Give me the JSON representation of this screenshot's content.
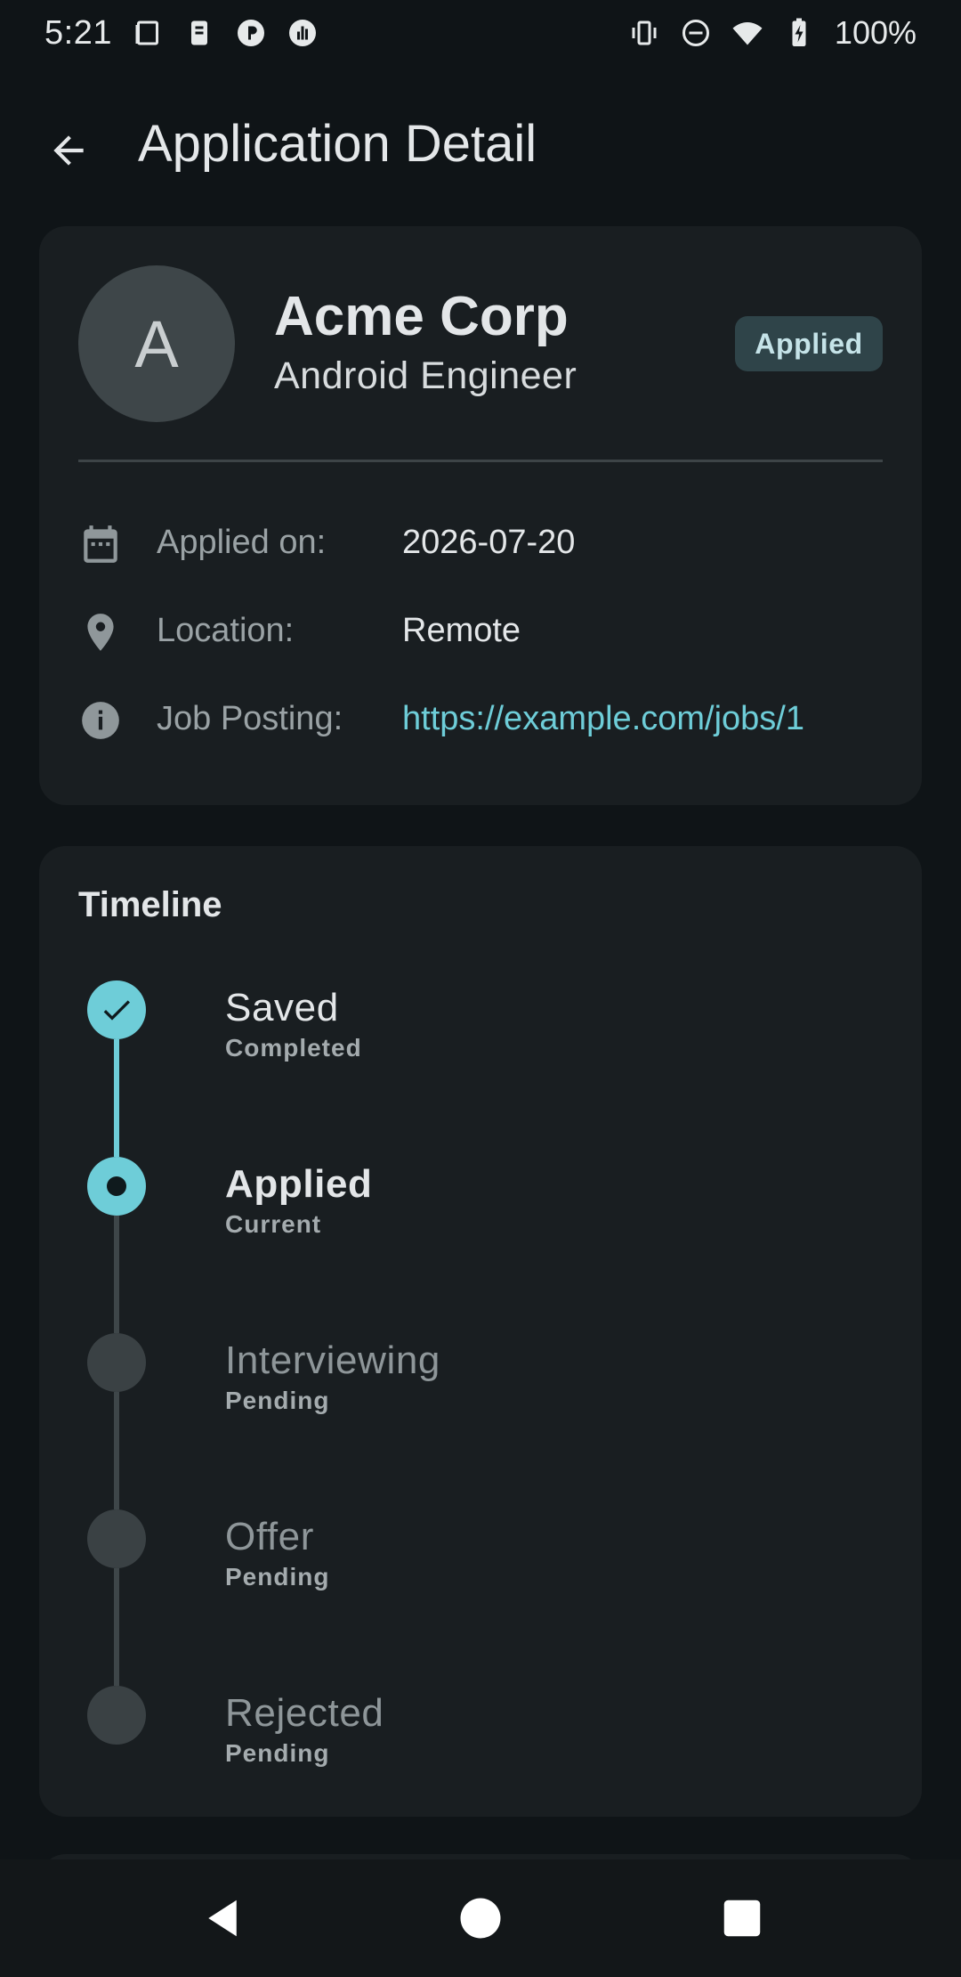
{
  "status_bar": {
    "time": "5:21",
    "battery_percent": "100%",
    "left_icons": [
      "notes-icon",
      "wallet-icon",
      "parking-icon",
      "stats-icon"
    ],
    "right_icons": [
      "vibrate-icon",
      "do-not-disturb-icon",
      "wifi-icon",
      "battery-charging-icon"
    ]
  },
  "app_bar": {
    "title": "Application Detail",
    "back_icon": "arrow-back-icon"
  },
  "application": {
    "avatar_letter": "A",
    "company": "Acme Corp",
    "position": "Android Engineer",
    "status": "Applied",
    "details": [
      {
        "icon": "calendar-icon",
        "label": "Applied on:",
        "value": "2026-07-20"
      },
      {
        "icon": "location-pin-icon",
        "label": "Location:",
        "value": "Remote"
      },
      {
        "icon": "info-icon",
        "label": "Job Posting:",
        "value": "https://example.com/jobs/1"
      }
    ]
  },
  "timeline": {
    "heading": "Timeline",
    "steps": [
      {
        "name": "Saved",
        "state": "Completed"
      },
      {
        "name": "Applied",
        "state": "Current"
      },
      {
        "name": "Interviewing",
        "state": "Pending"
      },
      {
        "name": "Offer",
        "state": "Pending"
      },
      {
        "name": "Rejected",
        "state": "Pending"
      }
    ]
  },
  "colors": {
    "background": "#0f1417",
    "card": "#191e21",
    "accent": "#6ecdd8",
    "chip": "#2f4449"
  },
  "nav_bar": {
    "buttons": [
      "back-triangle-icon",
      "home-circle-icon",
      "recents-square-icon"
    ]
  }
}
